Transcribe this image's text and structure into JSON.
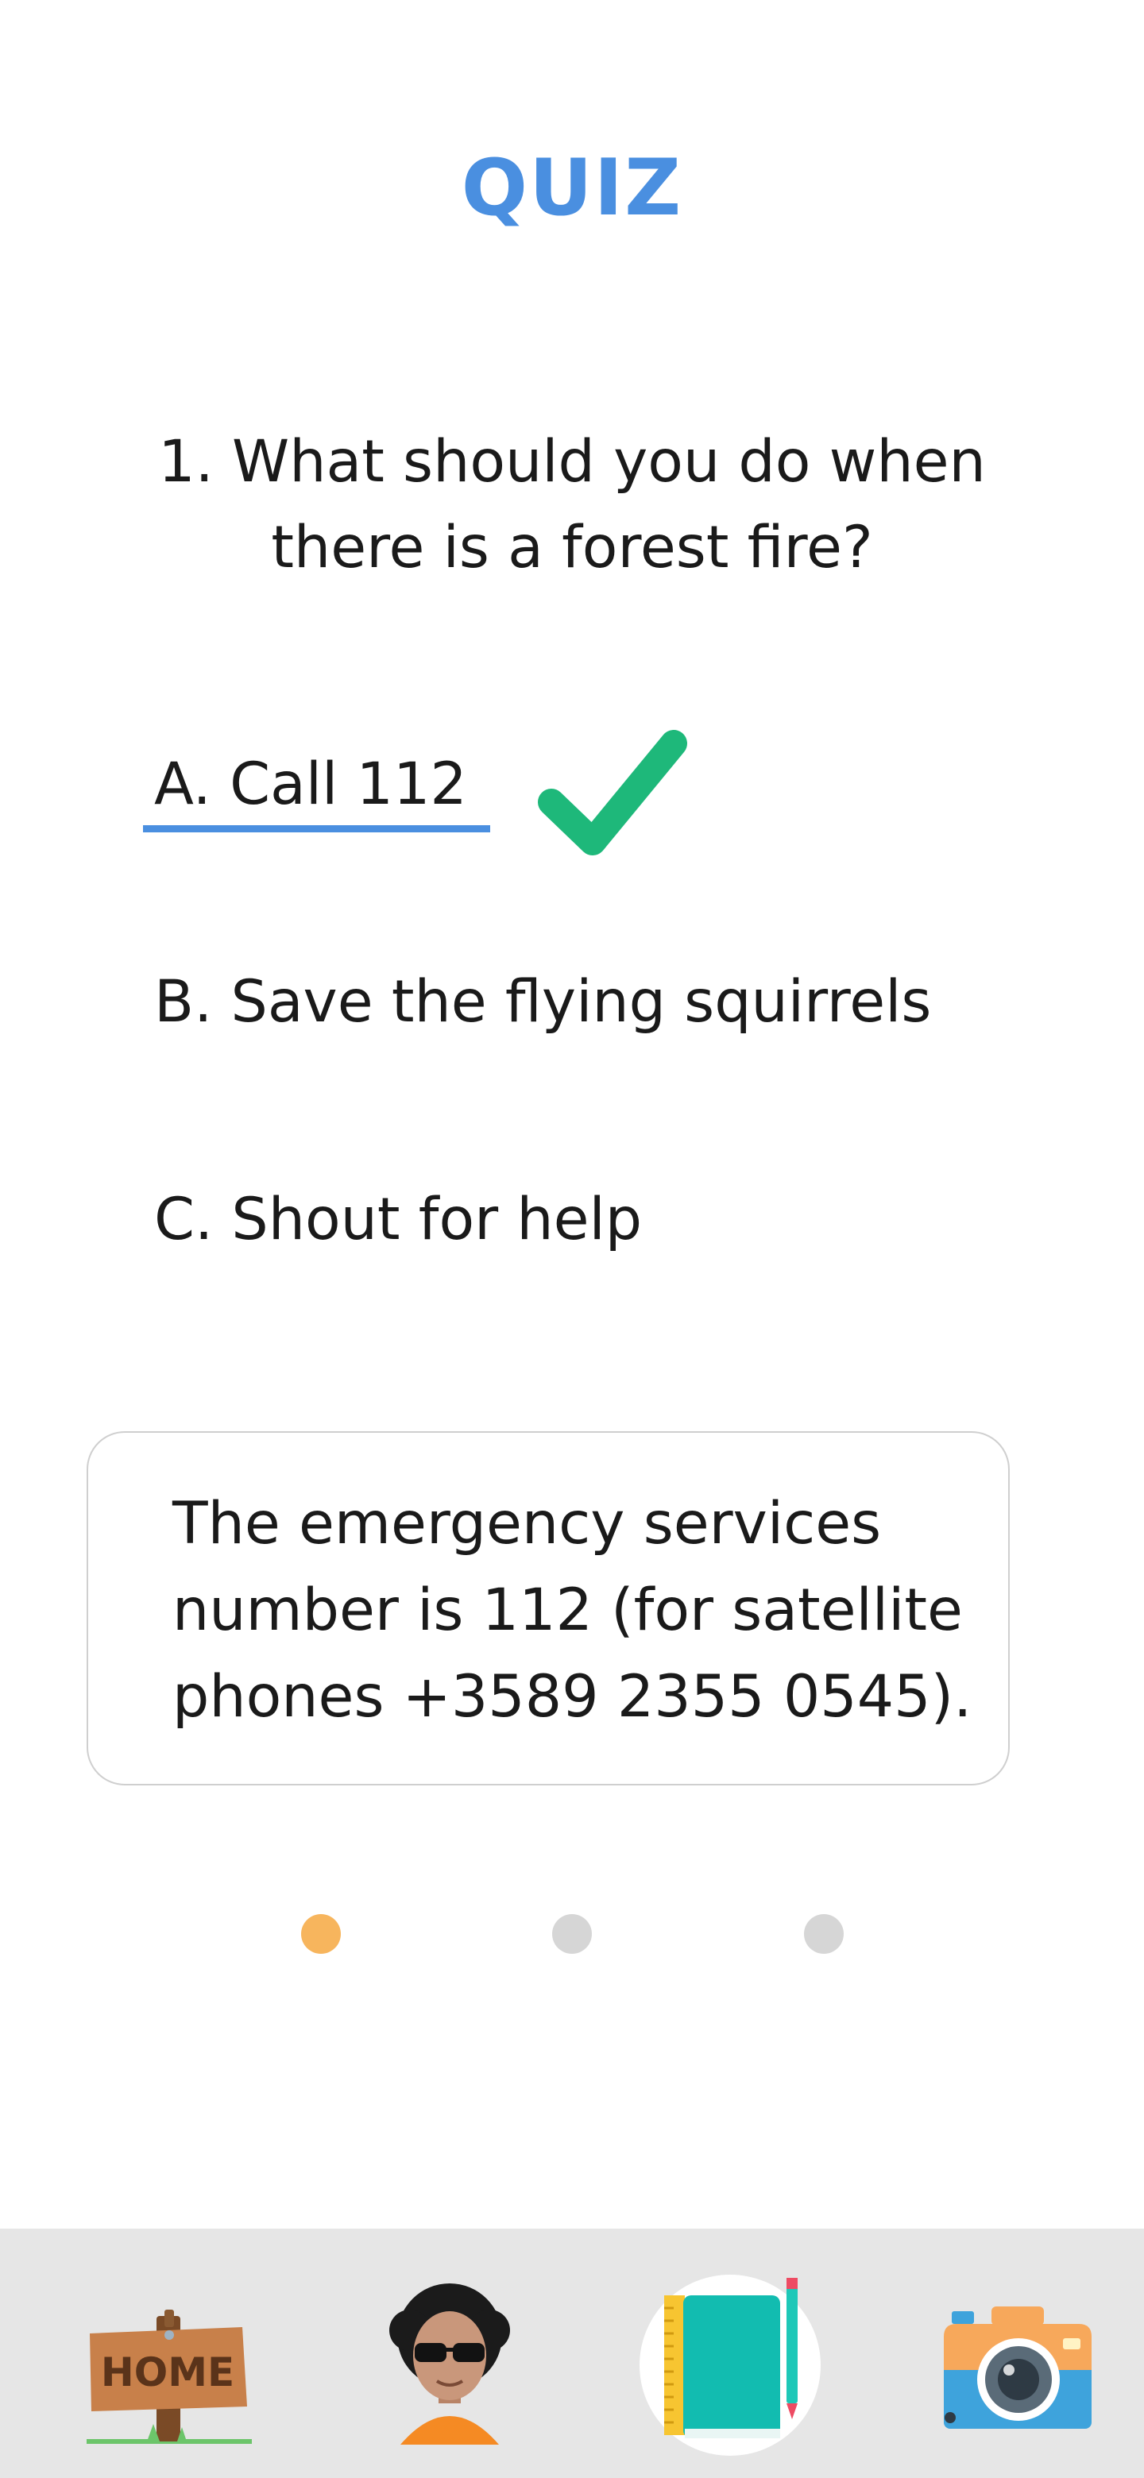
{
  "header": {
    "title": "QUIZ"
  },
  "question": {
    "text": "1. What should you do when there is a forest fire?"
  },
  "options": [
    {
      "label": "A. Call 112",
      "selected": true,
      "correct": true
    },
    {
      "label": "B. Save the flying squirrels",
      "selected": false
    },
    {
      "label": "C. Shout for help",
      "selected": false
    }
  ],
  "info": {
    "text": "The emergency services number is 112 (for satellite phones +3589 2355 0545)."
  },
  "pager": {
    "total": 3,
    "current": 1
  },
  "tabbar": {
    "items": [
      {
        "name": "home",
        "icon": "home-sign-icon",
        "sign_text": "HOME"
      },
      {
        "name": "profile",
        "icon": "avatar-icon"
      },
      {
        "name": "notes",
        "icon": "notebook-icon",
        "active": true
      },
      {
        "name": "camera",
        "icon": "camera-icon"
      }
    ]
  },
  "colors": {
    "accent": "#4a8fe0",
    "correct": "#1eb87a",
    "dot_active": "#f7b55d",
    "dot_inactive": "#d6d6d6",
    "tabbar_bg": "#e6e6e6"
  }
}
